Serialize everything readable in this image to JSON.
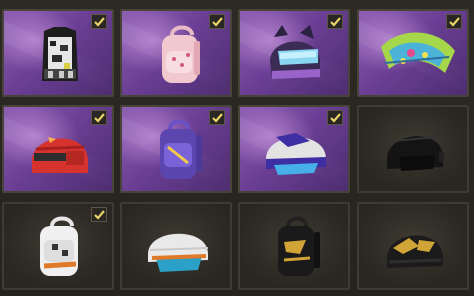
{
  "inventory": {
    "items": [
      {
        "icon": "camo-vest-icon",
        "theme": "purple",
        "checked": true
      },
      {
        "icon": "pink-backpack-icon",
        "theme": "purple",
        "checked": true
      },
      {
        "icon": "cat-ear-helmet-icon",
        "theme": "purple",
        "checked": true
      },
      {
        "icon": "parachute-icon",
        "theme": "purple",
        "checked": true
      },
      {
        "icon": "red-helmet-icon",
        "theme": "purple",
        "checked": true
      },
      {
        "icon": "purple-backpack-icon",
        "theme": "purple",
        "checked": true
      },
      {
        "icon": "blue-helmet-icon",
        "theme": "purple",
        "checked": true
      },
      {
        "icon": "black-helmet-icon",
        "theme": "dark",
        "checked": false
      },
      {
        "icon": "white-backpack-icon",
        "theme": "dark",
        "checked": true
      },
      {
        "icon": "white-helmet-icon",
        "theme": "dark",
        "checked": false
      },
      {
        "icon": "black-gold-backpack-icon",
        "theme": "dark",
        "checked": false
      },
      {
        "icon": "black-gold-helmet-icon",
        "theme": "dark",
        "checked": false
      }
    ],
    "colors": {
      "check": "#e8d36a",
      "border": "#494438",
      "purple": "#6b3f95",
      "dark": "#2f2c26"
    }
  }
}
